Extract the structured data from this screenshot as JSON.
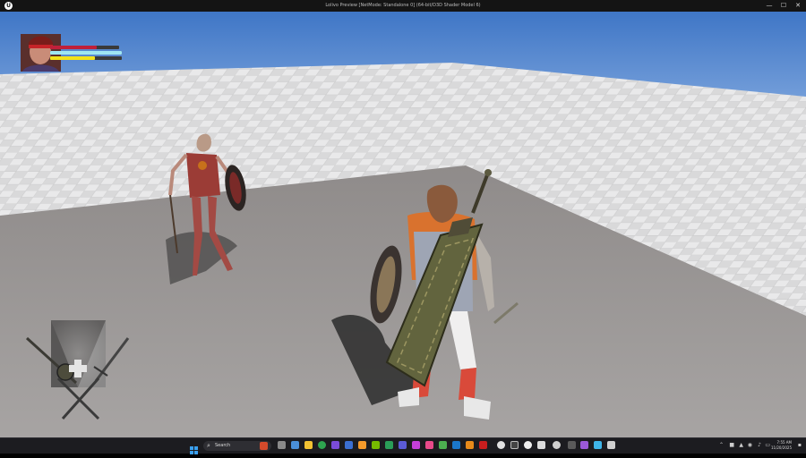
{
  "window": {
    "title": "Lolivo Preview [NetMode: Standalone 0]  (64-bit/D3D Shader Model 6)",
    "logo": "U",
    "minimize": "—",
    "maximize": "☐",
    "close": "✕"
  },
  "hud": {
    "health_fraction": 0.68,
    "mana_fraction": 1.0,
    "stamina_fraction": 0.62,
    "health_color": "#c0203a",
    "mana_color": "#9fe6f2",
    "stamina_color": "#f2e21a"
  },
  "taskbar": {
    "search_label": "Search",
    "clock_time": "7:55 AM",
    "clock_date": "11/20/2025"
  }
}
